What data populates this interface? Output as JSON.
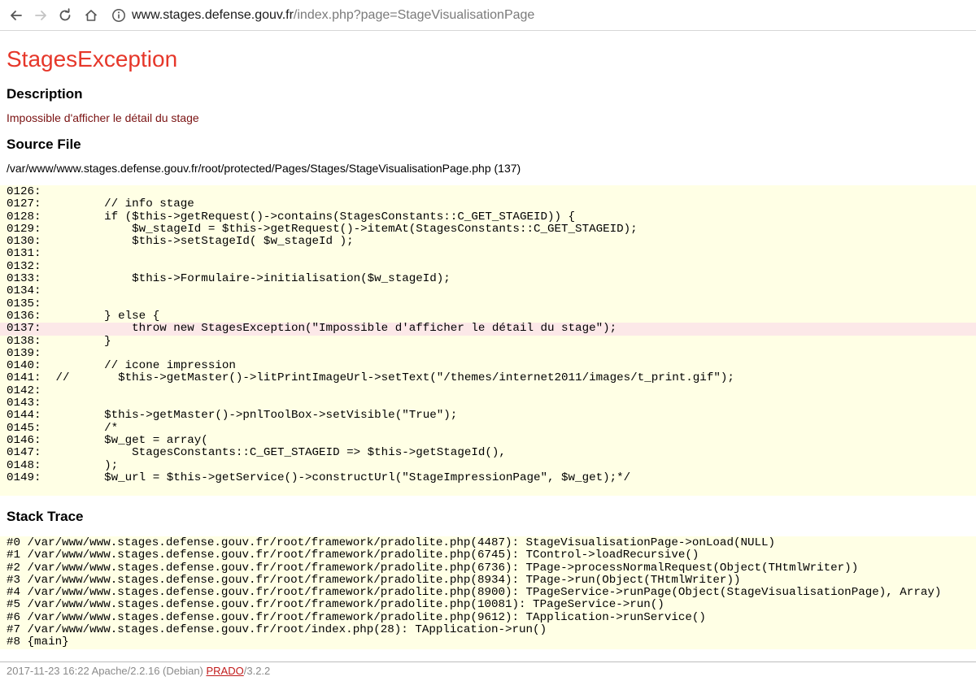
{
  "browser": {
    "url_host": "www.stages.defense.gouv.fr",
    "url_path": "/index.php?page=StageVisualisationPage",
    "icons": {
      "back": "arrow-left-icon",
      "forward": "arrow-right-icon",
      "reload": "reload-icon",
      "home": "home-icon",
      "info": "info-icon"
    }
  },
  "error": {
    "title": "StagesException",
    "description_heading": "Description",
    "description": "Impossible d'afficher le détail du stage",
    "source_heading": "Source File",
    "source_path": "/var/www/www.stages.defense.gouv.fr/root/protected/Pages/Stages/StageVisualisationPage.php (137)",
    "title_color": "#e6372a"
  },
  "source": {
    "error_line": "0137:",
    "lines": [
      {
        "num": "0126:",
        "code": ""
      },
      {
        "num": "0127:",
        "code": "        // info stage"
      },
      {
        "num": "0128:",
        "code": "        if ($this->getRequest()->contains(StagesConstants::C_GET_STAGEID)) {"
      },
      {
        "num": "0129:",
        "code": "            $w_stageId = $this->getRequest()->itemAt(StagesConstants::C_GET_STAGEID);"
      },
      {
        "num": "0130:",
        "code": "            $this->setStageId( $w_stageId );"
      },
      {
        "num": "0131:",
        "code": ""
      },
      {
        "num": "0132:",
        "code": ""
      },
      {
        "num": "0133:",
        "code": "            $this->Formulaire->initialisation($w_stageId);"
      },
      {
        "num": "0134:",
        "code": ""
      },
      {
        "num": "0135:",
        "code": ""
      },
      {
        "num": "0136:",
        "code": "        } else {"
      },
      {
        "num": "0137:",
        "code": "            throw new StagesException(\"Impossible d'afficher le détail du stage\");"
      },
      {
        "num": "0138:",
        "code": "        }"
      },
      {
        "num": "0139:",
        "code": ""
      },
      {
        "num": "0140:",
        "code": "        // icone impression"
      },
      {
        "num": "0141:",
        "code": " //       $this->getMaster()->litPrintImageUrl->setText(\"/themes/internet2011/images/t_print.gif\");"
      },
      {
        "num": "0142:",
        "code": ""
      },
      {
        "num": "0143:",
        "code": ""
      },
      {
        "num": "0144:",
        "code": "        $this->getMaster()->pnlToolBox->setVisible(\"True\");"
      },
      {
        "num": "0145:",
        "code": "        /*"
      },
      {
        "num": "0146:",
        "code": "        $w_get = array("
      },
      {
        "num": "0147:",
        "code": "            StagesConstants::C_GET_STAGEID => $this->getStageId(),"
      },
      {
        "num": "0148:",
        "code": "        );"
      },
      {
        "num": "0149:",
        "code": "        $w_url = $this->getService()->constructUrl(\"StageImpressionPage\", $w_get);*/"
      }
    ]
  },
  "stack": {
    "heading": "Stack Trace",
    "lines": [
      "#0 /var/www/www.stages.defense.gouv.fr/root/framework/pradolite.php(4487): StageVisualisationPage->onLoad(NULL)",
      "#1 /var/www/www.stages.defense.gouv.fr/root/framework/pradolite.php(6745): TControl->loadRecursive()",
      "#2 /var/www/www.stages.defense.gouv.fr/root/framework/pradolite.php(6736): TPage->processNormalRequest(Object(THtmlWriter))",
      "#3 /var/www/www.stages.defense.gouv.fr/root/framework/pradolite.php(8934): TPage->run(Object(THtmlWriter))",
      "#4 /var/www/www.stages.defense.gouv.fr/root/framework/pradolite.php(8900): TPageService->runPage(Object(StageVisualisationPage), Array)",
      "#5 /var/www/www.stages.defense.gouv.fr/root/framework/pradolite.php(10081): TPageService->run()",
      "#6 /var/www/www.stages.defense.gouv.fr/root/framework/pradolite.php(9612): TApplication->runService()",
      "#7 /var/www/www.stages.defense.gouv.fr/root/index.php(28): TApplication->run()",
      "#8 {main}"
    ]
  },
  "footer": {
    "prefix": "2017-11-23 16:22 Apache/2.2.16 (Debian) ",
    "link": "PRADO",
    "suffix": "/3.2.2"
  }
}
